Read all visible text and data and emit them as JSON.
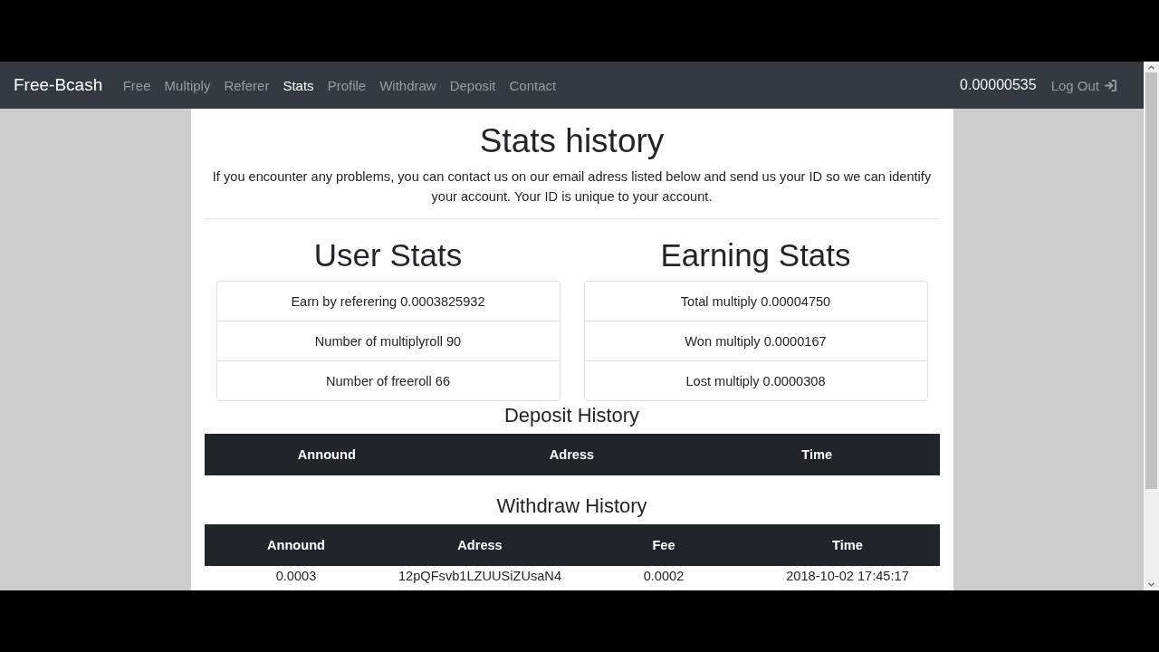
{
  "navbar": {
    "brand": "Free-Bcash",
    "links": [
      {
        "label": "Free",
        "selected": false
      },
      {
        "label": "Multiply",
        "selected": false
      },
      {
        "label": "Referer",
        "selected": false
      },
      {
        "label": "Stats",
        "selected": true
      },
      {
        "label": "Profile",
        "selected": false
      },
      {
        "label": "Withdraw",
        "selected": false
      },
      {
        "label": "Deposit",
        "selected": false
      },
      {
        "label": "Contact",
        "selected": false
      }
    ],
    "balance": "0.00000535",
    "logout": "Log Out"
  },
  "page": {
    "title": "Stats history",
    "intro": "If you encounter any problems, you can contact us on our email adress listed below and send us your ID so we can identify your account. Your ID is unique to your account."
  },
  "user_stats": {
    "title": "User Stats",
    "items": [
      "Earn by referering 0.0003825932",
      "Number of multiplyroll 90",
      "Number of freeroll 66"
    ]
  },
  "earning_stats": {
    "title": "Earning Stats",
    "items": [
      "Total multiply 0.00004750",
      "Won multiply 0.0000167",
      "Lost multiply 0.0000308"
    ]
  },
  "deposit_history": {
    "title": "Deposit History",
    "columns": [
      "Annound",
      "Adress",
      "Time"
    ]
  },
  "withdraw_history": {
    "title": "Withdraw History",
    "columns": [
      "Annound",
      "Adress",
      "Fee",
      "Time"
    ],
    "rows": [
      [
        "0.0003",
        "12pQFsvb1LZUUSiZUsaN4",
        "0.0002",
        "2018-10-02 17:45:17"
      ]
    ]
  }
}
